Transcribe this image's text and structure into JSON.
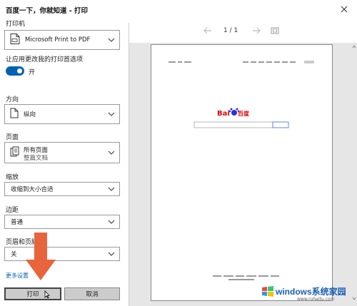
{
  "window": {
    "title": "百度一下，你就知道 - 打印"
  },
  "printer": {
    "label": "打印机",
    "selected": "Microsoft Print to PDF",
    "allow_apps_label": "让应用更改我的打印首选项",
    "toggle_state_label": "开",
    "toggle_on": true
  },
  "orientation": {
    "label": "方向",
    "selected": "纵向"
  },
  "pages": {
    "label": "页面",
    "selected": "所有页面",
    "sub": "整篇文档"
  },
  "scale": {
    "label": "缩放",
    "selected": "收缩到大小合适"
  },
  "margins": {
    "label": "边距",
    "selected": "普通"
  },
  "headers": {
    "label": "页眉和页脚",
    "selected": "关"
  },
  "more_settings": "更多设置",
  "buttons": {
    "print": "打印",
    "cancel": "取消"
  },
  "preview": {
    "page_indicator": "1 / 1",
    "logo_text": "Bai",
    "logo_suffix": "百度"
  },
  "watermark": {
    "text": "windows系统家园",
    "url": "www.ruhaitu.com"
  },
  "colors": {
    "accent": "#0063b1",
    "arrow": "#e8643c",
    "baidu_red": "#e10602",
    "baidu_blue": "#2932e1"
  }
}
